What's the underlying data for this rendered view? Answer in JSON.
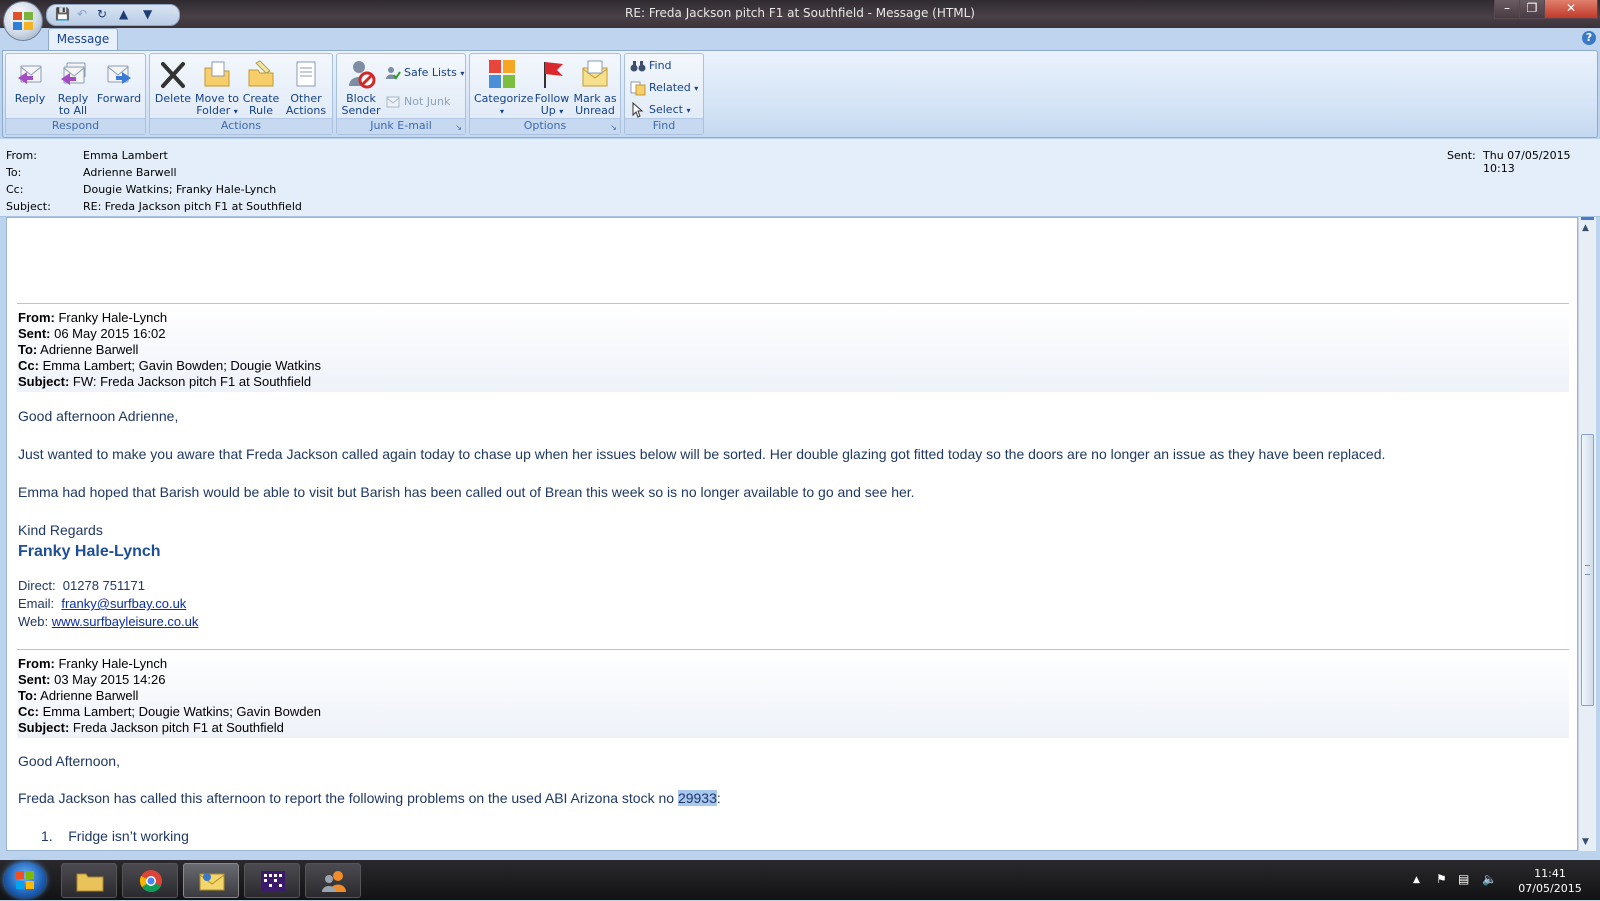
{
  "window": {
    "title": "RE: Freda Jackson pitch F1 at Southfield - Message (HTML)"
  },
  "ribbon": {
    "tab": "Message",
    "groups": {
      "respond": {
        "label": "Respond",
        "reply": "Reply",
        "reply_all_1": "Reply",
        "reply_all_2": "to All",
        "forward": "Forward"
      },
      "actions": {
        "label": "Actions",
        "delete": "Delete",
        "move_1": "Move to",
        "move_2": "Folder",
        "create_1": "Create",
        "create_2": "Rule",
        "other_1": "Other",
        "other_2": "Actions"
      },
      "junk": {
        "label": "Junk E-mail",
        "block_1": "Block",
        "block_2": "Sender",
        "safe_lists": "Safe Lists",
        "not_junk": "Not Junk"
      },
      "options": {
        "label": "Options",
        "categorize": "Categorize",
        "follow_1": "Follow",
        "follow_2": "Up",
        "mark_1": "Mark as",
        "mark_2": "Unread"
      },
      "find": {
        "label": "Find",
        "find": "Find",
        "related": "Related",
        "select": "Select"
      }
    }
  },
  "header": {
    "from_label": "From:",
    "from": "Emma Lambert",
    "to_label": "To:",
    "to": "Adrienne Barwell",
    "cc_label": "Cc:",
    "cc": "Dougie Watkins; Franky Hale-Lynch",
    "subject_label": "Subject:",
    "subject": "RE: Freda Jackson pitch F1 at Southfield",
    "sent_label": "Sent:",
    "sent": "Thu 07/05/2015 10:13"
  },
  "email1": {
    "from_label": "From:",
    "from": " Franky Hale-Lynch",
    "sent_label": "Sent:",
    "sent": " 06 May 2015 16:02",
    "to_label": "To:",
    "to": " Adrienne Barwell",
    "cc_label": "Cc:",
    "cc": " Emma Lambert; Gavin Bowden; Dougie Watkins",
    "subject_label": "Subject:",
    "subject": " FW: Freda Jackson pitch F1 at Southfield",
    "greeting": "Good afternoon Adrienne,",
    "para1": "Just wanted to make you aware that Freda Jackson called again today to chase up when her issues below will be sorted. Her double glazing got fitted today so the doors are no longer an issue as they have been replaced.",
    "para2": "Emma had hoped that Barish would be able to visit but Barish has been called out of Brean this week so is no longer available to go and see her.",
    "closing": "Kind Regards",
    "signature": "Franky Hale-Lynch",
    "direct_label": "Direct:",
    "direct": "01278 751171",
    "email_label": "Email:",
    "email": "franky@surfbay.co.uk",
    "web_label": "Web:",
    "web": "www.surfbayleisure.co.uk"
  },
  "email2": {
    "from_label": "From:",
    "from": " Franky Hale-Lynch",
    "sent_label": "Sent:",
    "sent": " 03 May 2015 14:26",
    "to_label": "To:",
    "to": " Adrienne Barwell",
    "cc_label": "Cc:",
    "cc": " Emma Lambert; Dougie Watkins; Gavin Bowden",
    "subject_label": "Subject:",
    "subject": " Freda Jackson pitch F1 at Southfield",
    "greeting": "Good Afternoon,",
    "para1_before": "Freda Jackson has called this afternoon to report the following problems on the used ABI Arizona stock no ",
    "para1_highlight": "29933",
    "para1_after": ":",
    "list1_num": "1.",
    "list1": "Fridge isn’t working"
  },
  "taskbar": {
    "time": "11:41",
    "date": "07/05/2015"
  },
  "colors": {
    "accent": "#15428b",
    "body_text": "#1f3864",
    "link": "#0a2ea8"
  }
}
